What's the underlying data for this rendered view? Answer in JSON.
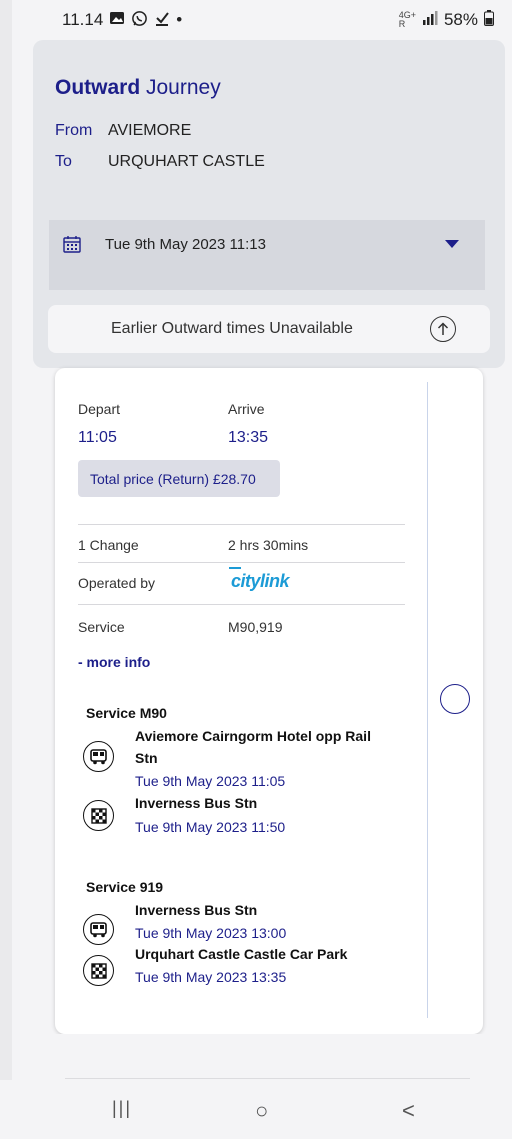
{
  "status_bar": {
    "time": "11.14",
    "notification_icons": [
      "image-icon",
      "whatsapp-icon",
      "download-done-icon"
    ],
    "dot": "•",
    "network_label_top": "4G+",
    "network_label_bottom": "R",
    "battery": "58%"
  },
  "journey": {
    "title_bold": "Outward",
    "title_rest": " Journey",
    "from_label": "From",
    "from_value": "AVIEMORE",
    "to_label": "To",
    "to_value": "URQUHART CASTLE",
    "date_value": "Tue 9th May 2023 11:13",
    "earlier_label": "Earlier Outward times Unavailable"
  },
  "result": {
    "depart_label": "Depart",
    "arrive_label": "Arrive",
    "depart_time": "11:05",
    "arrive_time": "13:35",
    "price": "Total price (Return) £28.70",
    "changes": "1 Change",
    "duration": "2 hrs 30mins",
    "operated_label": "Operated by",
    "operator": "citylink",
    "service_label": "Service",
    "service_value": "M90,919",
    "more_info": "- more info",
    "legs": [
      {
        "title": "Service M90",
        "from_stop_line1": "Aviemore Cairngorm Hotel opp Rail",
        "from_stop_line2": "Stn",
        "from_time": "Tue 9th May 2023 11:05",
        "to_stop": "Inverness Bus Stn",
        "to_time": "Tue 9th May 2023 11:50"
      },
      {
        "title": "Service 919",
        "from_stop": "Inverness Bus Stn",
        "from_time": "Tue 9th May 2023 13:00",
        "to_stop": "Urquhart Castle Castle Car Park",
        "to_time": "Tue 9th May 2023 13:35"
      }
    ]
  },
  "nav": {
    "recent": "|||",
    "home": "○",
    "back": "<"
  },
  "colors": {
    "accent": "#1d1f8a",
    "operator_blue": "#1c9bd6"
  }
}
